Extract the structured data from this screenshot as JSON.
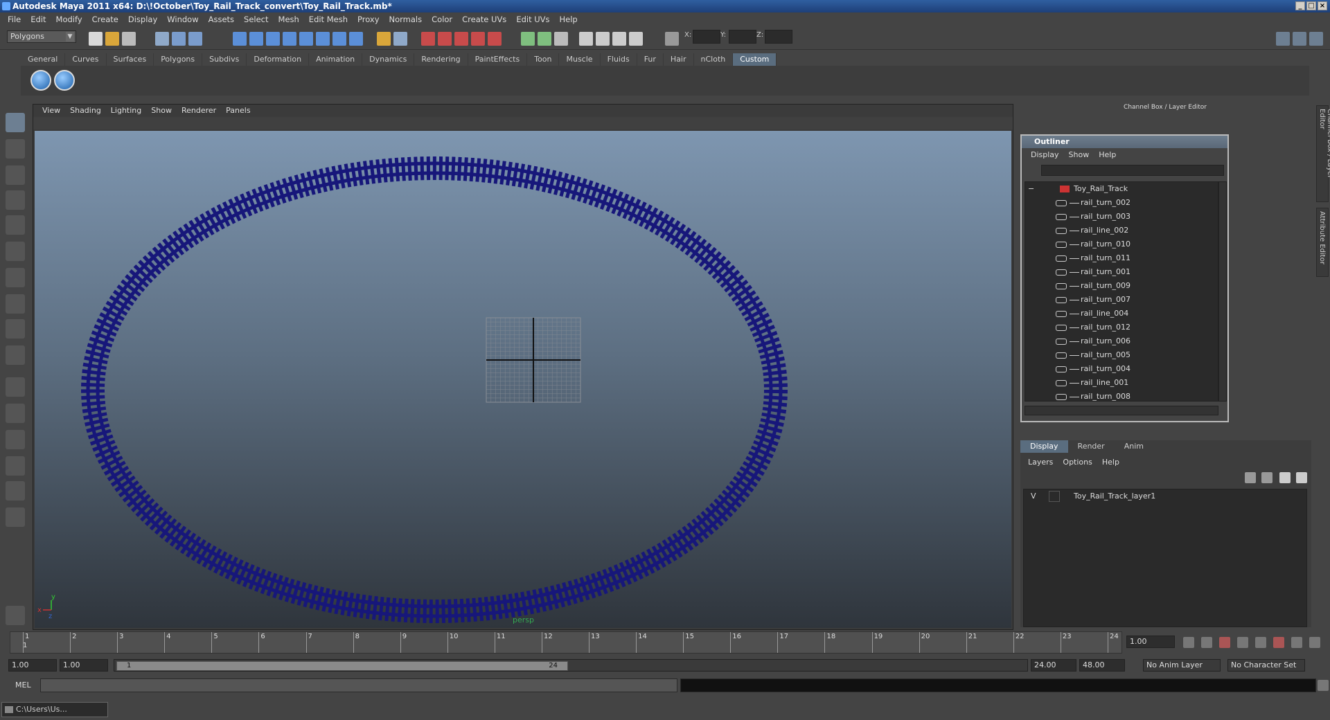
{
  "window": {
    "title": "Autodesk Maya 2011 x64: D:\\!October\\Toy_Rail_Track_convert\\Toy_Rail_Track.mb*",
    "controls": [
      "_",
      "□",
      "×"
    ]
  },
  "menubar": [
    "File",
    "Edit",
    "Modify",
    "Create",
    "Display",
    "Window",
    "Assets",
    "Select",
    "Mesh",
    "Edit Mesh",
    "Proxy",
    "Normals",
    "Color",
    "Create UVs",
    "Edit UVs",
    "Help"
  ],
  "statusline": {
    "mode": "Polygons",
    "x_label": "X:",
    "y_label": "Y:",
    "z_label": "Z:"
  },
  "shelf": {
    "tabs": [
      "General",
      "Curves",
      "Surfaces",
      "Polygons",
      "Subdivs",
      "Deformation",
      "Animation",
      "Dynamics",
      "Rendering",
      "PaintEffects",
      "Toon",
      "Muscle",
      "Fluids",
      "Fur",
      "Hair",
      "nCloth",
      "Custom"
    ],
    "active_tab": "Custom"
  },
  "viewport": {
    "menu": [
      "View",
      "Shading",
      "Lighting",
      "Show",
      "Renderer",
      "Panels"
    ],
    "camera": "persp",
    "axis_y": "y",
    "axis_x": "x",
    "axis_z": "z",
    "track_color": "#17177a"
  },
  "right_panel": {
    "header": "Channel Box / Layer Editor",
    "side_tab_channel": "Channel Box / Layer Editor",
    "side_tab_attr": "Attribute Editor"
  },
  "outliner": {
    "title": "Outliner",
    "menu": [
      "Display",
      "Show",
      "Help"
    ],
    "root": "Toy_Rail_Track",
    "expander": "−",
    "items": [
      "rail_turn_002",
      "rail_turn_003",
      "rail_line_002",
      "rail_turn_010",
      "rail_turn_011",
      "rail_turn_001",
      "rail_turn_009",
      "rail_turn_007",
      "rail_line_004",
      "rail_turn_012",
      "rail_turn_006",
      "rail_turn_005",
      "rail_turn_004",
      "rail_line_001",
      "rail_turn_008"
    ]
  },
  "layer_editor": {
    "tabs": [
      "Display",
      "Render",
      "Anim"
    ],
    "active_tab": "Display",
    "menu": [
      "Layers",
      "Options",
      "Help"
    ],
    "layers": [
      {
        "visible": "V",
        "name": "Toy_Rail_Track_layer1"
      }
    ]
  },
  "timeline": {
    "ticks": [
      "1",
      "2",
      "3",
      "4",
      "5",
      "6",
      "7",
      "8",
      "9",
      "10",
      "11",
      "12",
      "13",
      "14",
      "15",
      "16",
      "17",
      "18",
      "19",
      "20",
      "21",
      "22",
      "23",
      "24"
    ],
    "current_frame_marker": "1",
    "current_time": "1.00"
  },
  "range": {
    "start": "1.00",
    "playback_start": "1.00",
    "slider_start": "1",
    "slider_end": "24",
    "playback_end": "24.00",
    "end": "48.00",
    "anim_layer": "No Anim Layer",
    "character_set": "No Character Set"
  },
  "command_line": {
    "label": "MEL"
  },
  "taskbar": {
    "item": "C:\\Users\\Us..."
  }
}
